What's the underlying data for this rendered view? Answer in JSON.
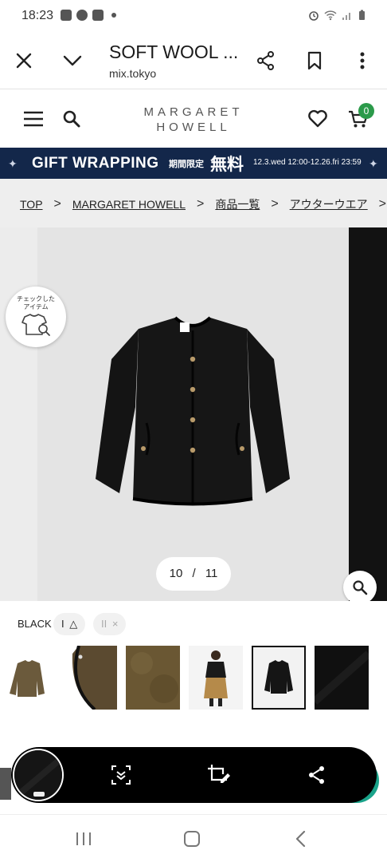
{
  "status_bar": {
    "time": "18:23",
    "left_icons": [
      "gallery-icon",
      "line-icon",
      "line-app-icon",
      "dot-icon"
    ],
    "right_icons": [
      "alarm-icon",
      "wifi-icon",
      "signal-icon",
      "battery-icon"
    ]
  },
  "toolbar": {
    "title": "SOFT WOOL ...",
    "url": "mix.tokyo",
    "icons": [
      "close-icon",
      "chevron-down-icon",
      "share-icon",
      "bookmark-icon",
      "more-icon"
    ]
  },
  "header": {
    "logo_line1": "MARGARET",
    "logo_line2": "HOWELL",
    "cart_count": "0"
  },
  "banner": {
    "text": "GIFT WRAPPING",
    "limited": "期間限定",
    "free": "無料",
    "dates": "12.3.wed 12:00-12.26.fri 23:59"
  },
  "breadcrumb": {
    "items": [
      "TOP",
      "MARGARET HOWELL",
      "商品一覧",
      "アウターウエア"
    ]
  },
  "gallery": {
    "check_label": "チェックした アイテム",
    "current": "10",
    "separator": "/",
    "total": "11"
  },
  "variants": {
    "color": "BLACK",
    "sizes": [
      {
        "label": "I",
        "mark": "△"
      },
      {
        "label": "II",
        "mark": "×"
      }
    ]
  },
  "colors": {
    "banner_bg": "#13274a",
    "badge": "#2b9a4a",
    "capture_accent": "#1aa38a"
  }
}
